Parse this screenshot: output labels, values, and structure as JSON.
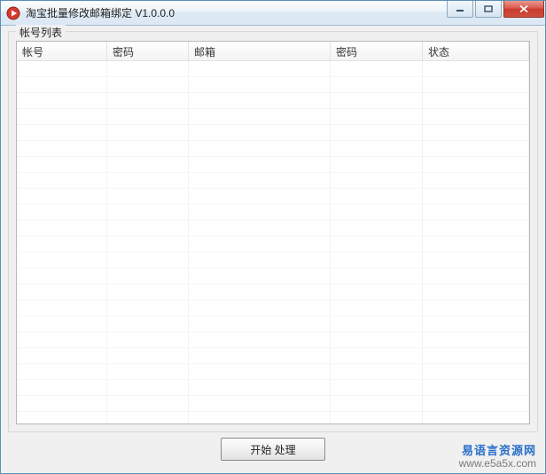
{
  "window": {
    "title": "淘宝批量修改邮箱绑定 V1.0.0.0"
  },
  "groupbox": {
    "label": "帐号列表"
  },
  "table": {
    "columns": [
      "帐号",
      "密码",
      "邮箱",
      "密码",
      "状态"
    ],
    "rows": []
  },
  "actions": {
    "start_label": "开始 处理"
  },
  "watermark": {
    "line1": "易语言资源网",
    "line2": "www.e5a5x.com"
  }
}
